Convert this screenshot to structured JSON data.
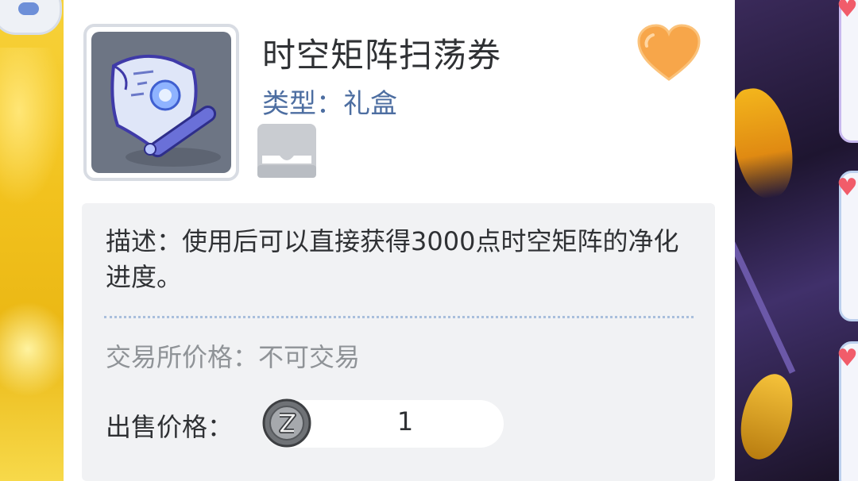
{
  "item": {
    "name": "时空矩阵扫荡券",
    "type_label": "类型：",
    "type_value": "礼盒",
    "icon": "scroll-icon"
  },
  "favorite": {
    "icon": "heart-icon",
    "color": "#f7a64a"
  },
  "description": {
    "text": "描述：使用后可以直接获得3000点时空矩阵的净化进度。"
  },
  "trade": {
    "label": "交易所价格：",
    "value": "不可交易"
  },
  "sell": {
    "label": "出售价格：",
    "currency_icon": "coin-icon",
    "value": "1"
  }
}
